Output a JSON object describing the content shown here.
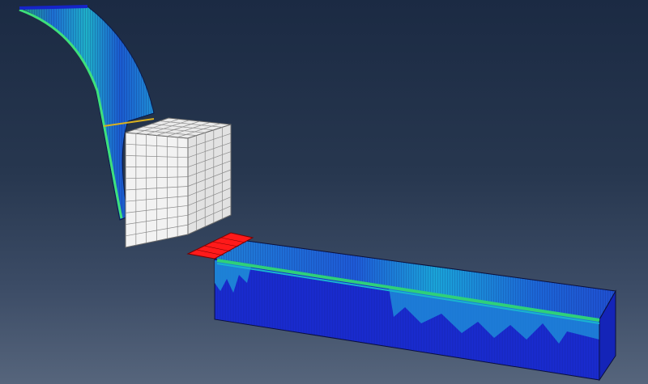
{
  "viewport": {
    "background_top": "#1b2a43",
    "background_bottom": "#56657c"
  },
  "scene": {
    "objects": [
      {
        "name": "curved-chip",
        "description_color": "#1f8f8a"
      },
      {
        "name": "rigid-cutting-tool",
        "description_color": "#ffffff"
      },
      {
        "name": "workpiece-block",
        "description_color": "#1a2fd6"
      },
      {
        "name": "removed-chip-segment",
        "description_color": "#ff1a1a"
      }
    ],
    "palette": {
      "deep_blue": "#1624c8",
      "blue": "#1f4fd8",
      "light_blue": "#1e90d8",
      "cyan": "#18b4d0",
      "green": "#2fd07a",
      "orange": "#d8b020",
      "red": "#ff1a1a",
      "mesh_line": "#0a0f3a",
      "tool_face": "#f2f2f2",
      "tool_line": "#8a8a8a"
    }
  }
}
